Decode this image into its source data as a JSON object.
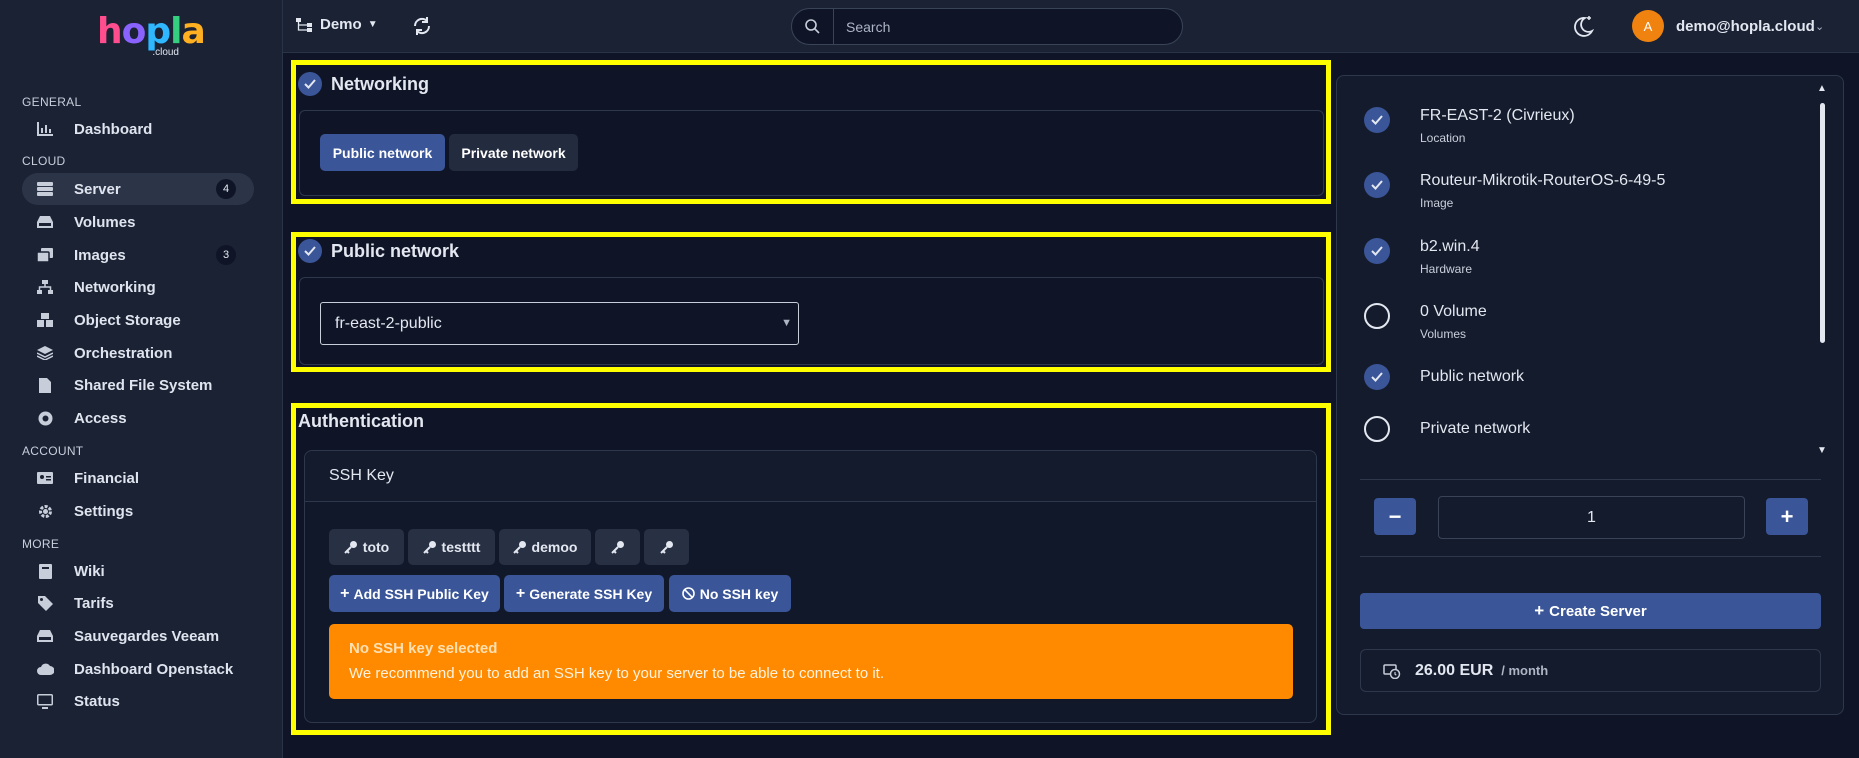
{
  "brand": {
    "logo_text": "hopla",
    "logo_sub": ".cloud"
  },
  "topbar": {
    "project": "Demo",
    "search_placeholder": "Search",
    "avatar_initial": "A",
    "user_email": "demo@hopla.cloud"
  },
  "sidebar": {
    "sections": {
      "general": "GENERAL",
      "cloud": "CLOUD",
      "account": "ACCOUNT",
      "more": "MORE"
    },
    "items": {
      "dashboard": "Dashboard",
      "server": "Server",
      "server_count": "4",
      "volumes": "Volumes",
      "images": "Images",
      "images_count": "3",
      "networking": "Networking",
      "object_storage": "Object Storage",
      "orchestration": "Orchestration",
      "shared_fs": "Shared File System",
      "access": "Access",
      "financial": "Financial",
      "settings": "Settings",
      "wiki": "Wiki",
      "tarifs": "Tarifs",
      "veeam": "Sauvegardes Veeam",
      "openstack": "Dashboard Openstack",
      "status": "Status"
    }
  },
  "networking": {
    "title": "Networking",
    "public_btn": "Public network",
    "private_btn": "Private network"
  },
  "public_network": {
    "title": "Public network",
    "selected": "fr-east-2-public"
  },
  "authentication": {
    "title": "Authentication",
    "card_title": "SSH Key",
    "keys": [
      "toto",
      "testttt",
      "demoo",
      "",
      ""
    ],
    "add_btn": "Add SSH Public Key",
    "generate_btn": "Generate SSH Key",
    "none_btn": "No SSH key",
    "alert_title": "No SSH key selected",
    "alert_text": "We recommend you to add an SSH key to your server to be able to connect to it."
  },
  "summary": {
    "items": [
      {
        "main": "FR-EAST-2 (Civrieux)",
        "sub": "Location",
        "done": true
      },
      {
        "main": "Routeur-Mikrotik-RouterOS-6-49-5",
        "sub": "Image",
        "done": true
      },
      {
        "main": "b2.win.4",
        "sub": "Hardware",
        "done": true
      },
      {
        "main": "0 Volume",
        "sub": "Volumes",
        "done": false
      },
      {
        "main": "Public network",
        "sub": "",
        "done": true
      },
      {
        "main": "Private network",
        "sub": "",
        "done": false
      }
    ],
    "quantity": "1",
    "create_btn": "Create Server",
    "price": "26.00 EUR",
    "period": "/ month"
  },
  "colors": {
    "accent": "#3a5598",
    "highlight": "#ffff00",
    "warning": "#ff8a00",
    "background": "#0f1527",
    "panel": "#1a2234"
  }
}
